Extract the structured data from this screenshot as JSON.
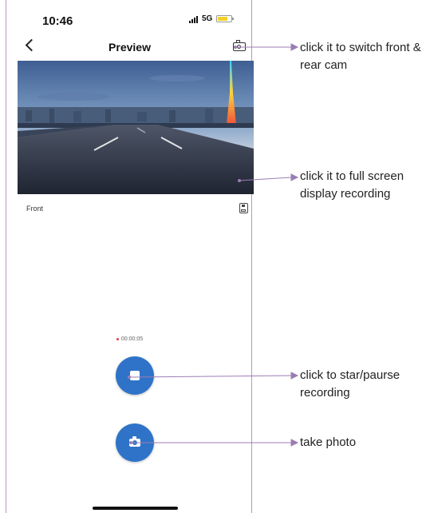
{
  "status_bar": {
    "time": "10:46",
    "network": "5G"
  },
  "header": {
    "title": "Preview"
  },
  "preview": {
    "camera_label": "Front"
  },
  "recording": {
    "elapsed": "00:00:05"
  },
  "annotations": {
    "switch_cam": "click it to switch front & rear cam",
    "fullscreen": "click it to full screen display recording",
    "record": "click to star/paurse recording",
    "photo": "take photo"
  },
  "colors": {
    "accent": "#2f73c9",
    "leader": "#9b7db3",
    "recording_dot": "#e23b3b"
  },
  "icons": [
    "back-icon",
    "switch-camera-icon",
    "fullscreen-icon",
    "sd-card-icon",
    "stop-icon",
    "camera-icon"
  ]
}
